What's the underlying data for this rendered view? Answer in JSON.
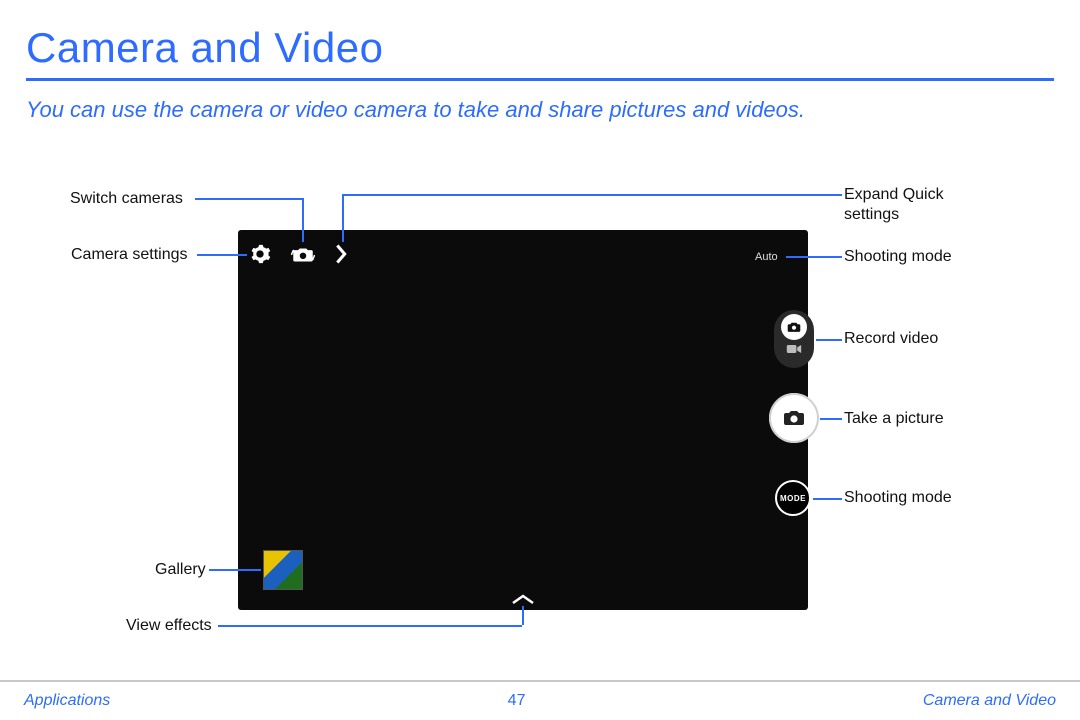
{
  "page": {
    "title": "Camera and Video",
    "intro": "You can use the camera or video camera to take and share pictures and videos."
  },
  "labels": {
    "switch_cameras": "Switch cameras",
    "camera_settings": "Camera settings",
    "gallery": "Gallery",
    "view_effects": "View effects",
    "expand_quick_settings": "Expand Quick settings",
    "shooting_mode_top": "Shooting mode",
    "record_video": "Record video",
    "take_a_picture": "Take a picture",
    "shooting_mode_btn": "Shooting mode"
  },
  "camera_ui": {
    "auto_badge": "Auto",
    "mode_button_text": "MODE"
  },
  "footer": {
    "left": "Applications",
    "page_number": "47",
    "right": "Camera and Video"
  }
}
